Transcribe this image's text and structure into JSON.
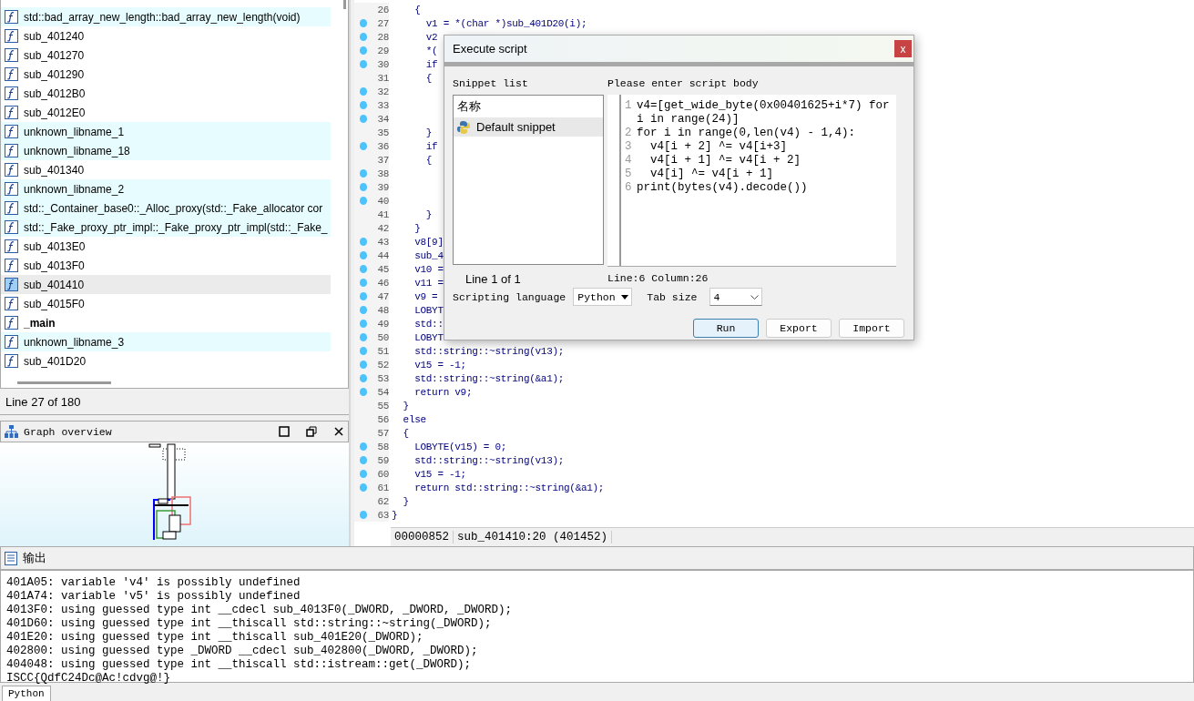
{
  "functions": {
    "items": [
      {
        "name": "std::bad_array_new_length::bad_array_new_length(void)",
        "kind": "library",
        "selected": false
      },
      {
        "name": "sub_401240",
        "kind": "regular",
        "selected": false
      },
      {
        "name": "sub_401270",
        "kind": "regular",
        "selected": false
      },
      {
        "name": "sub_401290",
        "kind": "regular",
        "selected": false
      },
      {
        "name": "sub_4012B0",
        "kind": "regular",
        "selected": false
      },
      {
        "name": "sub_4012E0",
        "kind": "regular",
        "selected": false
      },
      {
        "name": "unknown_libname_1",
        "kind": "library",
        "selected": false
      },
      {
        "name": "unknown_libname_18",
        "kind": "library",
        "selected": false
      },
      {
        "name": "sub_401340",
        "kind": "regular",
        "selected": false
      },
      {
        "name": "unknown_libname_2",
        "kind": "library",
        "selected": false
      },
      {
        "name": "std::_Container_base0::_Alloc_proxy(std::_Fake_allocator cor",
        "kind": "library",
        "selected": false
      },
      {
        "name": "std::_Fake_proxy_ptr_impl::_Fake_proxy_ptr_impl(std::_Fake_",
        "kind": "library",
        "selected": false
      },
      {
        "name": "sub_4013E0",
        "kind": "regular",
        "selected": false
      },
      {
        "name": "sub_4013F0",
        "kind": "regular",
        "selected": false
      },
      {
        "name": "sub_401410",
        "kind": "regular",
        "selected": true
      },
      {
        "name": "sub_4015F0",
        "kind": "regular",
        "selected": false
      },
      {
        "name": "_main",
        "kind": "main",
        "selected": false
      },
      {
        "name": "unknown_libname_3",
        "kind": "library",
        "selected": false
      },
      {
        "name": "sub_401D20",
        "kind": "regular",
        "selected": false
      }
    ],
    "status": "Line 27 of 180"
  },
  "graph_overview": {
    "title": "Graph overview"
  },
  "code": {
    "lines": [
      {
        "num": "26",
        "dot": false,
        "text": "    {"
      },
      {
        "num": "27",
        "dot": true,
        "text": "      v1 = *(char *)sub_401D20(i);"
      },
      {
        "num": "28",
        "dot": true,
        "text": "      v2"
      },
      {
        "num": "29",
        "dot": true,
        "text": "      *("
      },
      {
        "num": "30",
        "dot": true,
        "text": "      if"
      },
      {
        "num": "31",
        "dot": false,
        "text": "      {"
      },
      {
        "num": "32",
        "dot": true
      },
      {
        "num": "33",
        "dot": true
      },
      {
        "num": "34",
        "dot": true
      },
      {
        "num": "35",
        "dot": false,
        "text": "      }"
      },
      {
        "num": "36",
        "dot": true,
        "text": "      if"
      },
      {
        "num": "37",
        "dot": false,
        "text": "      {"
      },
      {
        "num": "38",
        "dot": true
      },
      {
        "num": "39",
        "dot": true
      },
      {
        "num": "40",
        "dot": true
      },
      {
        "num": "41",
        "dot": false,
        "text": "      }"
      },
      {
        "num": "42",
        "dot": false,
        "text": "    }"
      },
      {
        "num": "43",
        "dot": true,
        "text": "    v8[9]"
      },
      {
        "num": "44",
        "dot": true,
        "text": "    sub_4"
      },
      {
        "num": "45",
        "dot": true,
        "text": "    v10 ="
      },
      {
        "num": "46",
        "dot": true,
        "text": "    v11 ="
      },
      {
        "num": "47",
        "dot": true,
        "text": "    v9 ="
      },
      {
        "num": "48",
        "dot": true,
        "text": "    LOBYT"
      },
      {
        "num": "49",
        "dot": true,
        "text": "    std::"
      },
      {
        "num": "50",
        "dot": true,
        "text": "    LOBYT"
      },
      {
        "num": "51",
        "dot": true,
        "text": "    std::string::~string(v13);"
      },
      {
        "num": "52",
        "dot": true,
        "text": "    v15 = -1;"
      },
      {
        "num": "53",
        "dot": true,
        "text": "    std::string::~string(&a1);"
      },
      {
        "num": "54",
        "dot": true,
        "text": "    return v9;"
      },
      {
        "num": "55",
        "dot": false,
        "text": "  }"
      },
      {
        "num": "56",
        "dot": false,
        "text": "  else"
      },
      {
        "num": "57",
        "dot": false,
        "text": "  {"
      },
      {
        "num": "58",
        "dot": true,
        "text": "    LOBYTE(v15) = 0;"
      },
      {
        "num": "59",
        "dot": true,
        "text": "    std::string::~string(v13);"
      },
      {
        "num": "60",
        "dot": true,
        "text": "    v15 = -1;"
      },
      {
        "num": "61",
        "dot": true,
        "text": "    return std::string::~string(&a1);"
      },
      {
        "num": "62",
        "dot": false,
        "text": "  }"
      },
      {
        "num": "63",
        "dot": true,
        "text": "}"
      }
    ],
    "status": [
      "00000852",
      "sub_401410:20 (401452)"
    ]
  },
  "dialog": {
    "title": "Execute script",
    "close": "x",
    "snippet_label": "Snippet list",
    "snippet_header": "名称",
    "snippets": [
      {
        "name": "Default snippet",
        "selected": true
      }
    ],
    "snippet_status": "Line 1 of 1",
    "body_label": "Please enter script body",
    "script": [
      {
        "num": "1",
        "text": "v4=[get_wide_byte(0x00401625+i*7) for i in range(24)]"
      },
      {
        "num": "2",
        "text": "for i in range(0,len(v4) - 1,4):"
      },
      {
        "num": "3",
        "text": "  v4[i + 2] ^= v4[i+3]"
      },
      {
        "num": "4",
        "text": "  v4[i + 1] ^= v4[i + 2]"
      },
      {
        "num": "5",
        "text": "  v4[i] ^= v4[i + 1]"
      },
      {
        "num": "6",
        "text": "print(bytes(v4).decode())"
      }
    ],
    "cursor": "Line:6  Column:26",
    "language_label": "Scripting language",
    "language": "Python",
    "tab_label": "Tab size",
    "tab_size": "4",
    "buttons": [
      {
        "label": "Run",
        "default": true
      },
      {
        "label": "Export",
        "default": false
      },
      {
        "label": "Import",
        "default": false
      }
    ]
  },
  "output": {
    "title": "输出",
    "lines": [
      "401A05: variable 'v4' is possibly undefined",
      "401A74: variable 'v5' is possibly undefined",
      "4013F0: using guessed type int __cdecl sub_4013F0(_DWORD, _DWORD, _DWORD);",
      "401D60: using guessed type int __thiscall std::string::~string(_DWORD);",
      "401E20: using guessed type int __thiscall sub_401E20(_DWORD);",
      "402800: using guessed type _DWORD __cdecl sub_402800(_DWORD, _DWORD);",
      "404048: using guessed type int __thiscall std::istream::get(_DWORD);",
      "ISCC{QdfC24Dc@Ac!cdvg@!}"
    ],
    "input_tab": "Python"
  }
}
